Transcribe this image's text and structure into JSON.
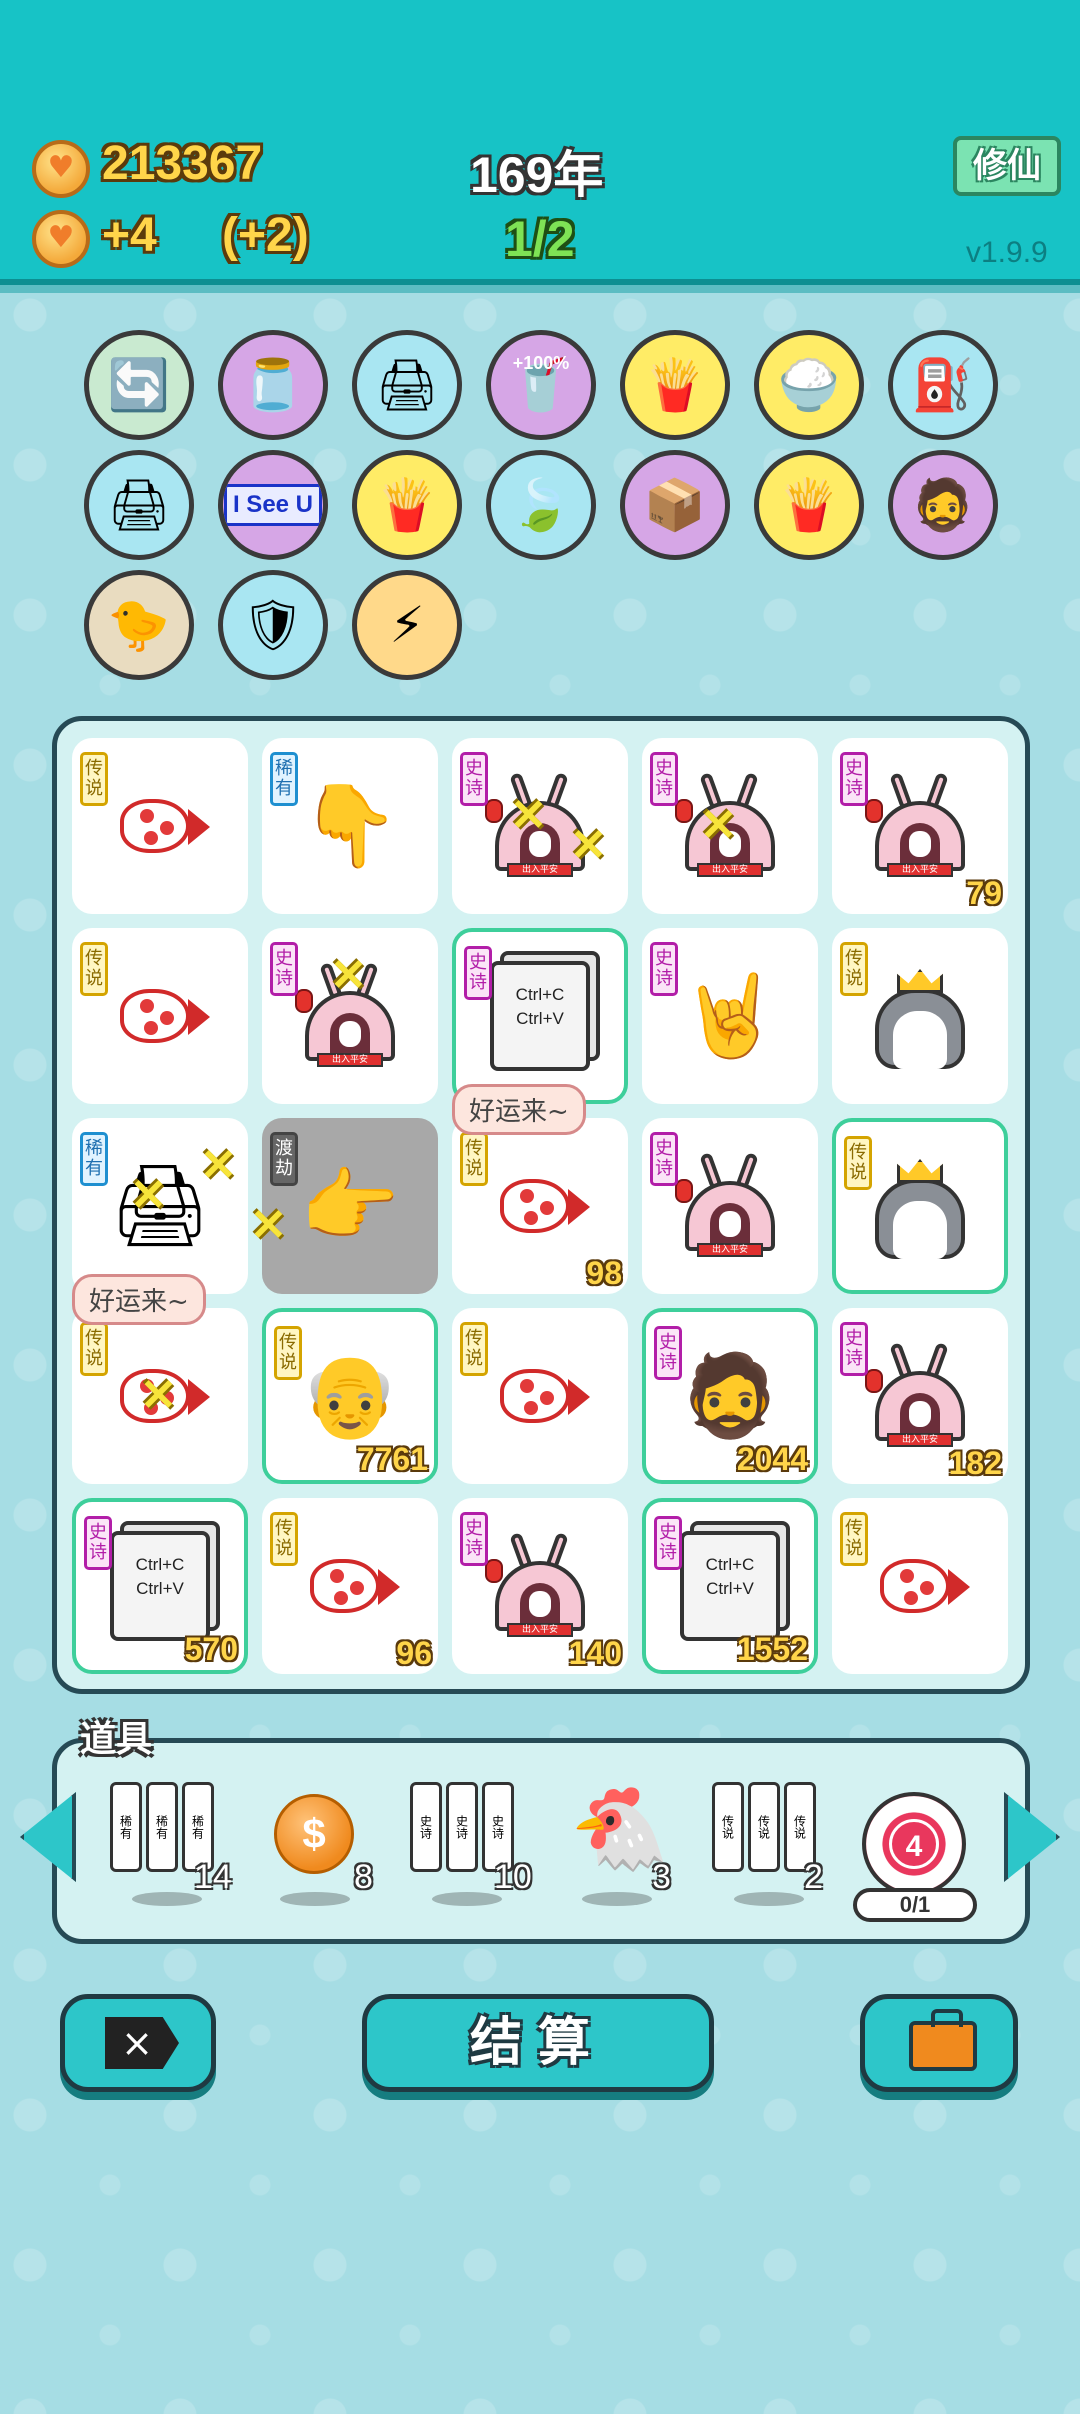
{
  "header": {
    "coins": "213367",
    "income": "+4",
    "income_bonus": "(+2)",
    "year": "169年",
    "progress": "1/2",
    "cultivate_label": "修仙",
    "version": "v1.9.9"
  },
  "relics": [
    {
      "icon": "refresh-icon",
      "bg": "#c9ead0"
    },
    {
      "icon": "jar-icon",
      "bg": "#d6a6e6"
    },
    {
      "icon": "printer-icon",
      "bg": "#a9e6f2"
    },
    {
      "icon": "cup-icon",
      "bg": "#d6a6e6",
      "label": "+100%"
    },
    {
      "icon": "fries-icon",
      "bg": "#ffec66"
    },
    {
      "icon": "rice-bowl-icon",
      "bg": "#ffec66"
    },
    {
      "icon": "pump-icon",
      "bg": "#a9e6f2"
    },
    {
      "icon": "printer-icon",
      "bg": "#a9e6f2"
    },
    {
      "icon": "i-see-u-icon",
      "bg": "#d6a6e6",
      "label": "I See U"
    },
    {
      "icon": "fries-icon",
      "bg": "#ffec66"
    },
    {
      "icon": "leaf-icon",
      "bg": "#a9e6f2"
    },
    {
      "icon": "box-icon",
      "bg": "#d6a6e6"
    },
    {
      "icon": "fries-icon",
      "bg": "#ffec66"
    },
    {
      "icon": "multiplier-head-icon",
      "bg": "#d6a6e6"
    },
    {
      "icon": "chick-icon",
      "bg": "#e9dcc0"
    },
    {
      "icon": "shield-wrench-icon",
      "bg": "#a9e6f2"
    },
    {
      "icon": "lightning-icon",
      "bg": "#ffd98a"
    }
  ],
  "board": {
    "rows": [
      [
        {
          "tag": "传说",
          "rarity": "legend",
          "icon": "koi-icon",
          "count": ""
        },
        {
          "tag": "稀有",
          "rarity": "rare",
          "icon": "pointing-hand-icon",
          "count": ""
        },
        {
          "tag": "史诗",
          "rarity": "epic",
          "icon": "tent-icon",
          "count": ""
        },
        {
          "tag": "史诗",
          "rarity": "epic",
          "icon": "tent-icon",
          "count": ""
        },
        {
          "tag": "史诗",
          "rarity": "epic",
          "icon": "tent-icon",
          "count": "79"
        }
      ],
      [
        {
          "tag": "传说",
          "rarity": "legend",
          "icon": "koi-icon",
          "count": ""
        },
        {
          "tag": "史诗",
          "rarity": "epic",
          "icon": "tent-icon",
          "count": ""
        },
        {
          "tag": "史诗",
          "rarity": "epic",
          "icon": "ctrl-card-icon",
          "count": ""
        },
        {
          "tag": "史诗",
          "rarity": "epic",
          "icon": "rock-hand-icon",
          "count": ""
        },
        {
          "tag": "传说",
          "rarity": "legend",
          "icon": "husky-icon",
          "count": ""
        }
      ],
      [
        {
          "tag": "稀有",
          "rarity": "rare",
          "icon": "printer-icon",
          "count": ""
        },
        {
          "tag": "渡劫",
          "rarity": "dujie",
          "icon": "yellow-hand-icon",
          "count": ""
        },
        {
          "tag": "传说",
          "rarity": "legend",
          "icon": "koi-icon",
          "count": "98"
        },
        {
          "tag": "史诗",
          "rarity": "epic",
          "icon": "tent-icon",
          "count": ""
        },
        {
          "tag": "传说",
          "rarity": "legend",
          "icon": "husky-icon",
          "count": ""
        }
      ],
      [
        {
          "tag": "传说",
          "rarity": "legend",
          "icon": "koi-icon",
          "count": ""
        },
        {
          "tag": "传说",
          "rarity": "legend",
          "icon": "bald-man-icon",
          "count": "7761"
        },
        {
          "tag": "传说",
          "rarity": "legend",
          "icon": "koi-icon",
          "count": ""
        },
        {
          "tag": "史诗",
          "rarity": "epic",
          "icon": "bearded-man-icon",
          "count": "2044"
        },
        {
          "tag": "史诗",
          "rarity": "epic",
          "icon": "tent-icon",
          "count": "182"
        }
      ],
      [
        {
          "tag": "史诗",
          "rarity": "epic",
          "icon": "ctrl-card-icon",
          "count": "570"
        },
        {
          "tag": "传说",
          "rarity": "legend",
          "icon": "koi-icon",
          "count": "96"
        },
        {
          "tag": "史诗",
          "rarity": "epic",
          "icon": "tent-icon",
          "count": "140"
        },
        {
          "tag": "史诗",
          "rarity": "epic",
          "icon": "ctrl-card-icon",
          "count": "1552"
        },
        {
          "tag": "传说",
          "rarity": "legend",
          "icon": "koi-icon",
          "count": ""
        }
      ]
    ],
    "ctrl_lines": [
      "Ctrl+C",
      "Ctrl+V"
    ],
    "tent_banner": "出入平安",
    "speech_1": "好运来~",
    "speech_2": "好运来~"
  },
  "items": {
    "title": "道具",
    "slots": [
      {
        "icon": "rare-scroll-icon",
        "count": "14",
        "scroll_label": "稀有"
      },
      {
        "icon": "dollar-coin-icon",
        "count": "8",
        "symbol": "$"
      },
      {
        "icon": "epic-scroll-icon",
        "count": "10",
        "scroll_label": "史诗"
      },
      {
        "icon": "chicken-icon",
        "count": "3"
      },
      {
        "icon": "legend-scroll-icon",
        "count": "2",
        "scroll_label": "传说"
      }
    ],
    "target_number": "4",
    "target_progress": "0/1"
  },
  "actions": {
    "close_icon": "×",
    "settle_label": "结算"
  }
}
